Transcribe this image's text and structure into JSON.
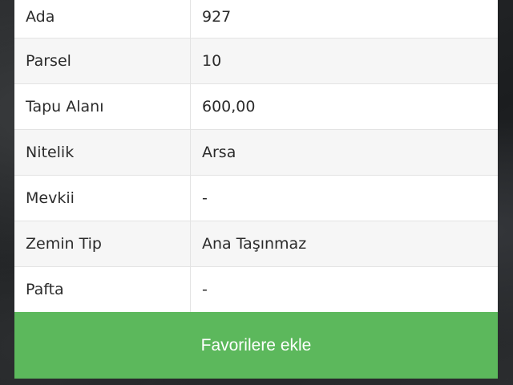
{
  "details": {
    "rows": [
      {
        "label": "Ada",
        "value": "927"
      },
      {
        "label": "Parsel",
        "value": "10"
      },
      {
        "label": "Tapu Alanı",
        "value": "600,00"
      },
      {
        "label": "Nitelik",
        "value": "Arsa"
      },
      {
        "label": "Mevkii",
        "value": "-"
      },
      {
        "label": "Zemin Tip",
        "value": "Ana Taşınmaz"
      },
      {
        "label": "Pafta",
        "value": "-"
      }
    ]
  },
  "actions": {
    "favorite_label": "Favorilere ekle"
  },
  "colors": {
    "accent": "#5cb85c",
    "row_alt": "#f6f6f6",
    "border": "#e3e3e3"
  }
}
